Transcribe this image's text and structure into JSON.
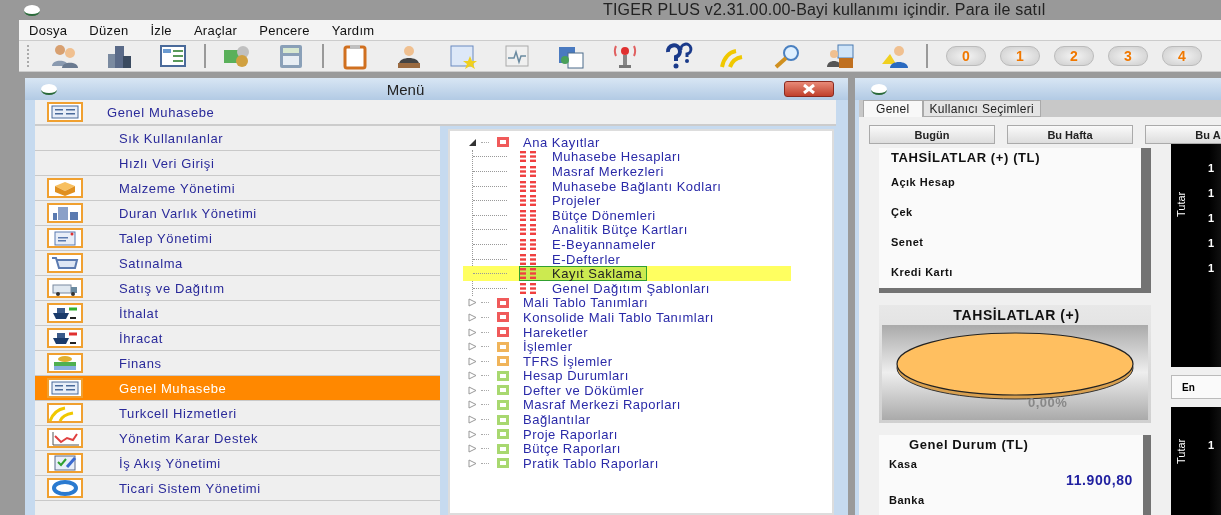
{
  "title_bar": {
    "title": "TIGER PLUS v2.31.00.00-Bayi kullanımı içindir. Para ile satıl"
  },
  "menu_bar": [
    "Dosya",
    "Düzen",
    "İzle",
    "Araçlar",
    "Pencere",
    "Yardım"
  ],
  "toolbar": {
    "number_buttons": [
      "0",
      "1",
      "2",
      "3",
      "4"
    ]
  },
  "menu_window": {
    "title": "Menü",
    "module_header": "Genel Muhasebe",
    "modules": [
      {
        "label": "Sık Kullanılanlar",
        "kind": "plain",
        "selected": false
      },
      {
        "label": "Hızlı Veri Girişi",
        "kind": "plain",
        "selected": false
      },
      {
        "label": "Malzeme Yönetimi",
        "kind": "icon",
        "selected": false
      },
      {
        "label": "Duran Varlık Yönetimi",
        "kind": "icon",
        "selected": false
      },
      {
        "label": "Talep Yönetimi",
        "kind": "icon",
        "selected": false
      },
      {
        "label": "Satınalma",
        "kind": "icon",
        "selected": false
      },
      {
        "label": "Satış ve Dağıtım",
        "kind": "icon",
        "selected": false
      },
      {
        "label": "İthalat",
        "kind": "icon",
        "selected": false
      },
      {
        "label": "İhracat",
        "kind": "icon",
        "selected": false
      },
      {
        "label": "Finans",
        "kind": "icon",
        "selected": false
      },
      {
        "label": "Genel Muhasebe",
        "kind": "icon",
        "selected": true
      },
      {
        "label": "Turkcell Hizmetleri",
        "kind": "icon",
        "selected": false
      },
      {
        "label": "Yönetim Karar Destek",
        "kind": "icon",
        "selected": false
      },
      {
        "label": "İş Akış Yönetimi",
        "kind": "icon",
        "selected": false
      },
      {
        "label": "Ticari Sistem Yönetimi",
        "kind": "icon",
        "selected": false
      }
    ],
    "tree": [
      {
        "label": "Ana Kayıtlar",
        "color": "#f05a5a",
        "expanded": true,
        "selected": false,
        "children": [
          {
            "label": "Muhasebe Hesapları",
            "selected": false
          },
          {
            "label": "Masraf Merkezleri",
            "selected": false
          },
          {
            "label": "Muhasebe Bağlantı Kodları",
            "selected": false
          },
          {
            "label": "Projeler",
            "selected": false
          },
          {
            "label": "Bütçe Dönemleri",
            "selected": false
          },
          {
            "label": "Analitik Bütçe Kartları",
            "selected": false
          },
          {
            "label": "E-Beyannameler",
            "selected": false
          },
          {
            "label": "E-Defterler",
            "selected": false
          },
          {
            "label": "Kayıt Saklama",
            "selected": true
          },
          {
            "label": "Genel Dağıtım Şablonları",
            "selected": false
          }
        ]
      },
      {
        "label": "Mali Tablo Tanımları",
        "color": "#f05a5a",
        "expanded": false,
        "selected": false
      },
      {
        "label": "Konsolide Mali Tablo Tanımları",
        "color": "#f05a5a",
        "expanded": false,
        "selected": false
      },
      {
        "label": "Hareketler",
        "color": "#f05a5a",
        "expanded": false,
        "selected": false
      },
      {
        "label": "İşlemler",
        "color": "#f0b45a",
        "expanded": false,
        "selected": false
      },
      {
        "label": "TFRS İşlemler",
        "color": "#f0b45a",
        "expanded": false,
        "selected": false
      },
      {
        "label": "Hesap Durumları",
        "color": "#a8d870",
        "expanded": false,
        "selected": false
      },
      {
        "label": "Defter ve Dökümler",
        "color": "#a8d870",
        "expanded": false,
        "selected": false
      },
      {
        "label": "Masraf Merkezi Raporları",
        "color": "#a8d870",
        "expanded": false,
        "selected": false
      },
      {
        "label": "Bağlantılar",
        "color": "#a8d870",
        "expanded": false,
        "selected": false
      },
      {
        "label": "Proje Raporları",
        "color": "#a8d870",
        "expanded": false,
        "selected": false
      },
      {
        "label": "Bütçe Raporları",
        "color": "#a8d870",
        "expanded": false,
        "selected": false
      },
      {
        "label": "Pratik Tablo Raporları",
        "color": "#a8d870",
        "expanded": false,
        "selected": false
      }
    ]
  },
  "dashboard": {
    "tabs": [
      {
        "label": "Genel",
        "selected": true
      },
      {
        "label": "Kullanıcı Seçimleri",
        "selected": false
      }
    ],
    "period_buttons": [
      "Bugün",
      "Bu Hafta",
      "Bu A"
    ],
    "collections_card": {
      "title": "TAHSİLATLAR (+) (TL)",
      "rows": [
        "Açık Hesap",
        "Çek",
        "Senet",
        "Kredi Kartı"
      ]
    },
    "pie_card": {
      "title": "TAHSİLATLAR (+)",
      "label": "0,00%"
    },
    "status_card": {
      "title": "Genel Durum (TL)",
      "rows": [
        {
          "label": "Kasa",
          "value": "11.900,80"
        },
        {
          "label": "Banka"
        }
      ]
    },
    "charts": [
      {
        "ylabel": "Tutar",
        "ticks": [
          "1",
          "1",
          "1",
          "1",
          "1"
        ]
      },
      {
        "ylabel": "Tutar",
        "ticks": [
          "1"
        ]
      }
    ],
    "chart_button": "En"
  }
}
